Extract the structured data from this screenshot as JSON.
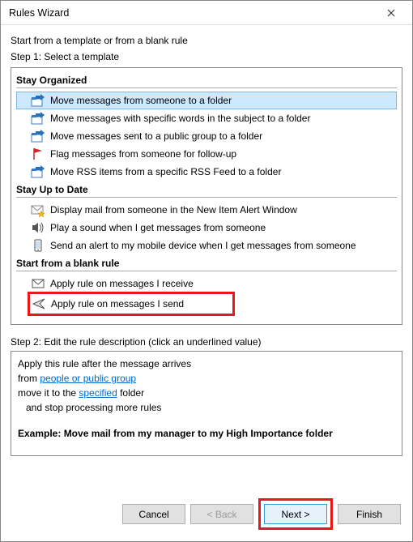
{
  "window": {
    "title": "Rules Wizard"
  },
  "intro": "Start from a template or from a blank rule",
  "step1_label": "Step 1: Select a template",
  "sections": {
    "stay_organized": "Stay Organized",
    "stay_up_to_date": "Stay Up to Date",
    "blank_rule": "Start from a blank rule"
  },
  "templates": {
    "move_from_someone": "Move messages from someone to a folder",
    "move_subject_words": "Move messages with specific words in the subject to a folder",
    "move_public_group": "Move messages sent to a public group to a folder",
    "flag_followup": "Flag messages from someone for follow-up",
    "move_rss": "Move RSS items from a specific RSS Feed to a folder",
    "display_alert": "Display mail from someone in the New Item Alert Window",
    "play_sound": "Play a sound when I get messages from someone",
    "mobile_alert": "Send an alert to my mobile device when I get messages from someone",
    "apply_receive": "Apply rule on messages I receive",
    "apply_send": "Apply rule on messages I send"
  },
  "step2_label": "Step 2: Edit the rule description (click an underlined value)",
  "description": {
    "line1": "Apply this rule after the message arrives",
    "line2_prefix": "from ",
    "line2_link": "people or public group",
    "line3_prefix": "move it to the ",
    "line3_link": "specified",
    "line3_suffix": " folder",
    "line4": "and stop processing more rules",
    "example": "Example: Move mail from my manager to my High Importance folder"
  },
  "buttons": {
    "cancel": "Cancel",
    "back": "< Back",
    "next": "Next >",
    "finish": "Finish"
  }
}
